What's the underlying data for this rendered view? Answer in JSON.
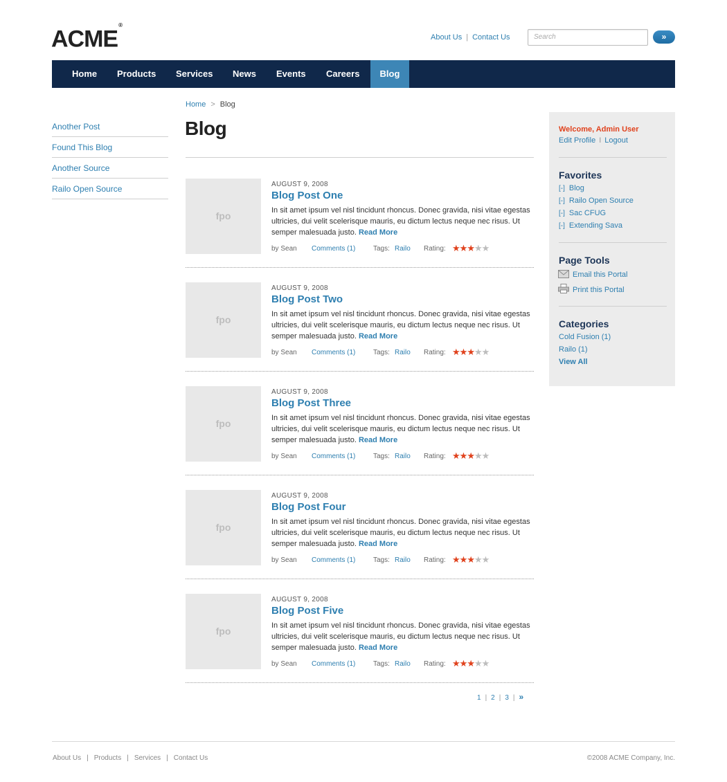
{
  "header": {
    "logo": "ACME",
    "logo_mark": "®",
    "util_links": [
      "About Us",
      "Contact Us"
    ],
    "util_sep": "|",
    "search_placeholder": "Search",
    "search_button": "»"
  },
  "nav": {
    "items": [
      "Home",
      "Products",
      "Services",
      "News",
      "Events",
      "Careers",
      "Blog"
    ],
    "active": "Blog"
  },
  "left_nav": {
    "items": [
      "Another Post",
      "Found This Blog",
      "Another Source",
      "Railo Open Source"
    ]
  },
  "breadcrumb": {
    "home": "Home",
    "sep": ">",
    "current": "Blog"
  },
  "page_title": "Blog",
  "posts": [
    {
      "thumb": "fpo",
      "date": "AUGUST 9, 2008",
      "title": "Blog Post One",
      "excerpt": "In sit amet ipsum vel nisl tincidunt rhoncus. Donec gravida, nisi vitae egestas ultricies, dui velit scelerisque mauris, eu dictum lectus neque nec risus. Ut semper malesuada justo.",
      "read_more": "Read More",
      "author": "by Sean",
      "comments": "Comments (1)",
      "tags_label": "Tags:",
      "tag": "Railo",
      "rating_label": "Rating:",
      "rating": 3,
      "rating_max": 5
    },
    {
      "thumb": "fpo",
      "date": "AUGUST 9, 2008",
      "title": "Blog Post Two",
      "excerpt": "In sit amet ipsum vel nisl tincidunt rhoncus. Donec gravida, nisi vitae egestas ultricies, dui velit scelerisque mauris, eu dictum lectus neque nec risus. Ut semper malesuada justo.",
      "read_more": "Read More",
      "author": "by Sean",
      "comments": "Comments (1)",
      "tags_label": "Tags:",
      "tag": "Railo",
      "rating_label": "Rating:",
      "rating": 3,
      "rating_max": 5
    },
    {
      "thumb": "fpo",
      "date": "AUGUST 9, 2008",
      "title": "Blog Post Three",
      "excerpt": "In sit amet ipsum vel nisl tincidunt rhoncus. Donec gravida, nisi vitae egestas ultricies, dui velit scelerisque mauris, eu dictum lectus neque nec risus. Ut semper malesuada justo.",
      "read_more": "Read More",
      "author": "by Sean",
      "comments": "Comments (1)",
      "tags_label": "Tags:",
      "tag": "Railo",
      "rating_label": "Rating:",
      "rating": 3,
      "rating_max": 5
    },
    {
      "thumb": "fpo",
      "date": "AUGUST 9, 2008",
      "title": "Blog Post Four",
      "excerpt": "In sit amet ipsum vel nisl tincidunt rhoncus. Donec gravida, nisi vitae egestas ultricies, dui velit scelerisque mauris, eu dictum lectus neque nec risus. Ut semper malesuada justo.",
      "read_more": "Read More",
      "author": "by Sean",
      "comments": "Comments (1)",
      "tags_label": "Tags:",
      "tag": "Railo",
      "rating_label": "Rating:",
      "rating": 3,
      "rating_max": 5
    },
    {
      "thumb": "fpo",
      "date": "AUGUST 9, 2008",
      "title": "Blog Post Five",
      "excerpt": "In sit amet ipsum vel nisl tincidunt rhoncus. Donec gravida, nisi vitae egestas ultricies, dui velit scelerisque mauris, eu dictum lectus neque nec risus. Ut semper malesuada justo.",
      "read_more": "Read More",
      "author": "by Sean",
      "comments": "Comments (1)",
      "tags_label": "Tags:",
      "tag": "Railo",
      "rating_label": "Rating:",
      "rating": 3,
      "rating_max": 5
    }
  ],
  "pager": {
    "pages": [
      "1",
      "2",
      "3"
    ],
    "next": "»",
    "sep": "|"
  },
  "sidebar": {
    "welcome": "Welcome, Admin User",
    "edit_profile": "Edit Profile",
    "logout": "Logout",
    "profile_sep": "I",
    "favorites_heading": "Favorites",
    "favorites_bracket": "[-]",
    "favorites": [
      "Blog",
      "Railo Open Source",
      "Sac CFUG",
      "Extending Sava"
    ],
    "tools_heading": "Page Tools",
    "tools": [
      {
        "label": "Email this Portal",
        "icon": "envelope-icon"
      },
      {
        "label": "Print this Portal",
        "icon": "printer-icon"
      }
    ],
    "categories_heading": "Categories",
    "categories": [
      "Cold Fusion (1)",
      "Railo (1)"
    ],
    "view_all": "View All"
  },
  "footer": {
    "links": [
      "About Us",
      "Products",
      "Services",
      "Contact Us"
    ],
    "sep": "|",
    "copyright": "©2008 ACME Company, Inc."
  },
  "colors": {
    "nav_bg": "#10284a",
    "nav_active": "#3d86b6",
    "link": "#2e7fb0",
    "accent": "#e0421d",
    "sidebar_bg": "#ececec",
    "heading_dark": "#1d3557"
  }
}
